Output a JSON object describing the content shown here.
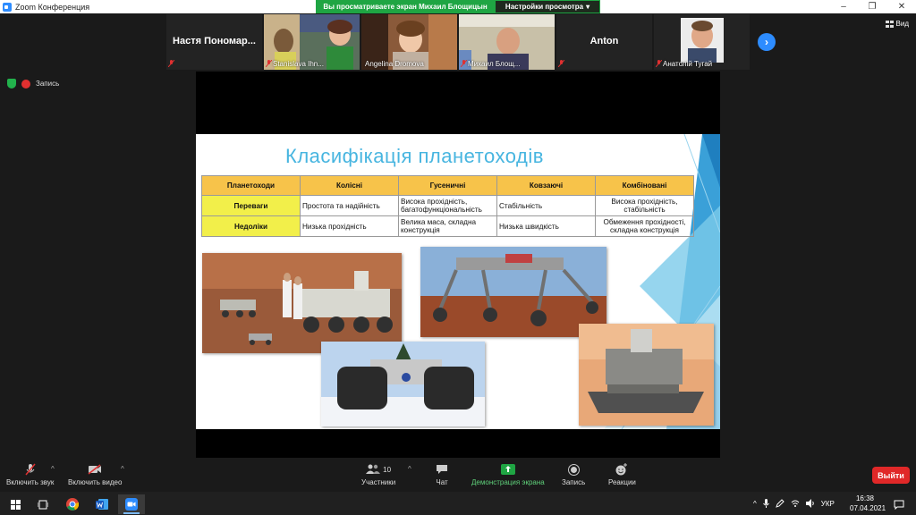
{
  "window": {
    "title": "Zoom Конференция",
    "minimize": "–",
    "maximize": "❐",
    "close": "✕"
  },
  "share_bar": {
    "banner": "Вы просматриваете экран Михаил Блощицын",
    "view_settings": "Настройки просмотра",
    "view_settings_caret": "▾"
  },
  "gallery": {
    "participants": [
      {
        "name": "Настя  Пономар...",
        "video": false
      },
      {
        "name": "Stanislava Ihn...",
        "video": true
      },
      {
        "name": "Angelina Dromova",
        "video": true
      },
      {
        "name": "Михаил Блощ...",
        "video": true
      },
      {
        "name": "Anton",
        "video": false
      },
      {
        "name": "Анатолій Тугай",
        "video": true
      }
    ],
    "next": "›",
    "view_label": "Вид"
  },
  "status": {
    "recording": "Запись"
  },
  "slide": {
    "title": "Класифікація планетоходів",
    "table": {
      "headers": [
        "Планетоходи",
        "Колісні",
        "Гусеничні",
        "Ковзаючі",
        "Комбіновані"
      ],
      "rows": [
        {
          "label": "Переваги",
          "cells": [
            "Простота та надійність",
            "Висока прохідність, багатофункціональність",
            "Стабільність",
            "Висока прохідність, стабільність"
          ]
        },
        {
          "label": "Недоліки",
          "cells": [
            "Низька прохідність",
            "Велика маса, складна конструкція",
            "Низька швидкість",
            "Обмеження прохідності, складна конструкція"
          ]
        }
      ]
    }
  },
  "toolbar": {
    "audio": "Включить звук",
    "video": "Включить видео",
    "participants": "Участники",
    "participants_count": "10",
    "chat": "Чат",
    "share": "Демонстрация экрана",
    "record": "Запись",
    "reactions": "Реакции",
    "exit": "Выйти",
    "caret": "^"
  },
  "taskbar": {
    "language": "УКР",
    "time": "16:38",
    "date": "07.04.2021",
    "tray_caret": "^"
  },
  "colors": {
    "zoom_blue": "#2d8cff",
    "share_green": "#1fa543",
    "exit_red": "#e02828",
    "table_header": "#f7c34a",
    "table_rowhead": "#f2ef4a",
    "slide_title": "#47b5e0"
  }
}
